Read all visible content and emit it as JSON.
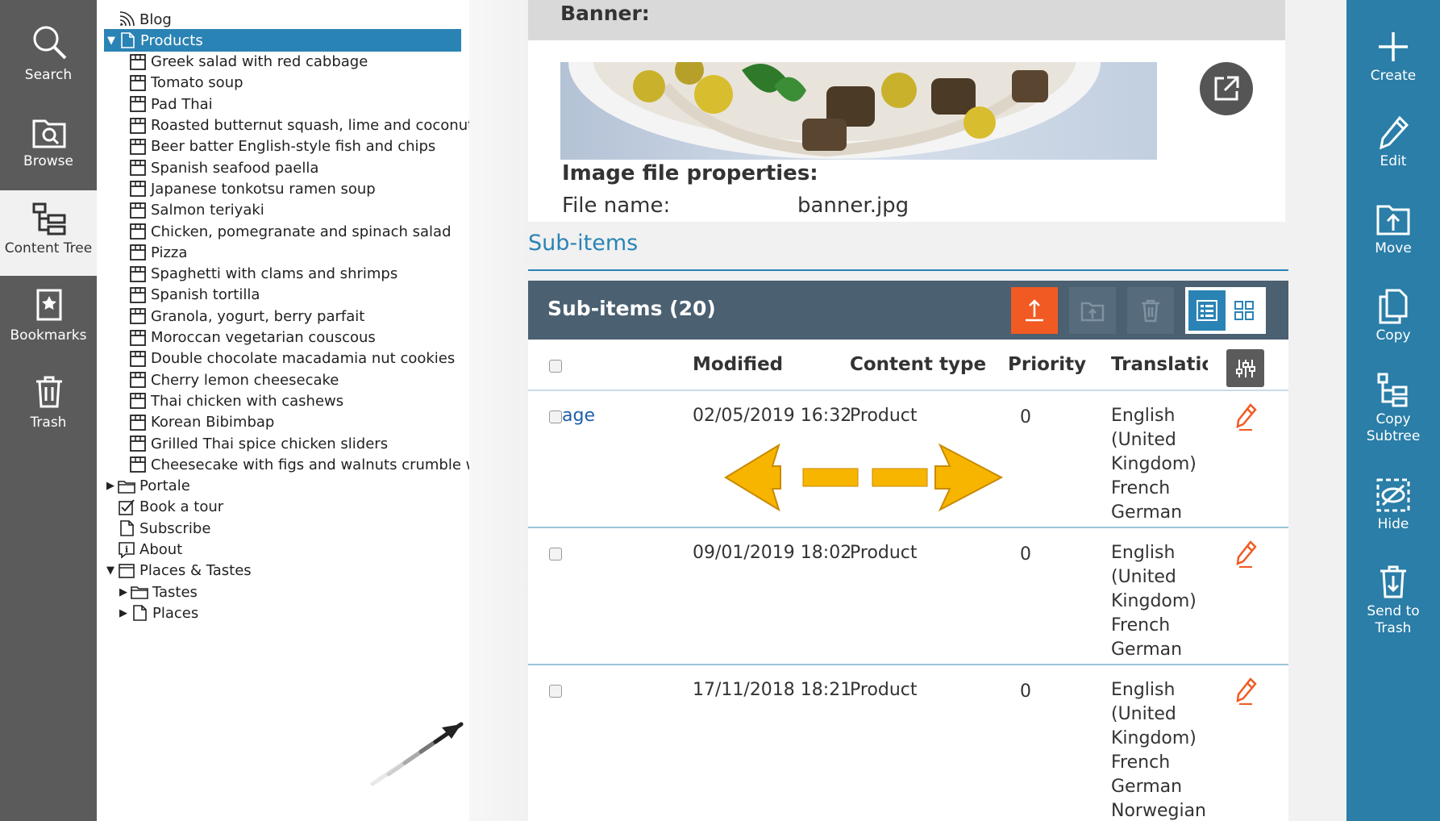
{
  "left_nav": {
    "items": [
      {
        "label": "Search",
        "icon": "search-icon"
      },
      {
        "label": "Browse",
        "icon": "browse-icon"
      },
      {
        "label": "Content Tree",
        "icon": "content-tree-icon",
        "active": true
      },
      {
        "label": "Bookmarks",
        "icon": "bookmark-icon"
      },
      {
        "label": "Trash",
        "icon": "trash-icon"
      }
    ]
  },
  "tree": {
    "items": [
      {
        "label": "Blog",
        "icon": "rss-icon",
        "toggle": ""
      },
      {
        "label": "Products",
        "icon": "page-icon",
        "toggle": "▼",
        "selected": true
      },
      {
        "label": "Greek salad with red cabbage",
        "icon": "product-icon"
      },
      {
        "label": "Tomato soup",
        "icon": "product-icon"
      },
      {
        "label": "Pad Thai",
        "icon": "product-icon"
      },
      {
        "label": "Roasted butternut squash, lime and coconut s",
        "icon": "product-icon"
      },
      {
        "label": "Beer batter English-style fish and chips",
        "icon": "product-icon"
      },
      {
        "label": "Spanish seafood paella",
        "icon": "product-icon"
      },
      {
        "label": "Japanese tonkotsu ramen soup",
        "icon": "product-icon"
      },
      {
        "label": "Salmon teriyaki",
        "icon": "product-icon"
      },
      {
        "label": "Chicken, pomegranate and spinach salad",
        "icon": "product-icon"
      },
      {
        "label": "Pizza",
        "icon": "product-icon"
      },
      {
        "label": "Spaghetti with clams and shrimps",
        "icon": "product-icon"
      },
      {
        "label": "Spanish tortilla",
        "icon": "product-icon"
      },
      {
        "label": "Granola, yogurt, berry parfait",
        "icon": "product-icon"
      },
      {
        "label": "Moroccan vegetarian couscous",
        "icon": "product-icon"
      },
      {
        "label": "Double chocolate macadamia nut cookies",
        "icon": "product-icon"
      },
      {
        "label": "Cherry lemon cheesecake",
        "icon": "product-icon"
      },
      {
        "label": "Thai chicken with cashews",
        "icon": "product-icon"
      },
      {
        "label": "Korean Bibimbap",
        "icon": "product-icon"
      },
      {
        "label": "Grilled Thai spice chicken sliders",
        "icon": "product-icon"
      },
      {
        "label": "Cheesecake with figs and walnuts crumble wit",
        "icon": "product-icon"
      },
      {
        "label": "Portale",
        "icon": "folder-icon",
        "toggle": "▶"
      },
      {
        "label": "Book a tour",
        "icon": "checkbox-icon",
        "toggle": ""
      },
      {
        "label": "Subscribe",
        "icon": "page-icon",
        "toggle": ""
      },
      {
        "label": "About",
        "icon": "info-icon",
        "toggle": ""
      },
      {
        "label": "Places & Tastes",
        "icon": "window-icon",
        "toggle": "▼"
      },
      {
        "label": "Tastes",
        "icon": "folder-icon",
        "toggle": "▶"
      },
      {
        "label": "Places",
        "icon": "page-icon",
        "toggle": "▶"
      }
    ]
  },
  "banner": {
    "heading": "Banner:",
    "image_props_title": "Image file properties:",
    "file_name_label": "File name:",
    "file_name_value": "banner.jpg"
  },
  "subitems": {
    "heading": "Sub-items",
    "bar_title": "Sub-items (20)",
    "columns": {
      "modified": "Modified",
      "content_type": "Content type",
      "priority": "Priority",
      "translations": "Translatioı"
    },
    "rows": [
      {
        "name": "age",
        "modified": "02/05/2019 16:32",
        "content_type": "Product",
        "priority": "0",
        "translations": [
          "English",
          "(United",
          "Kingdom)",
          "French",
          "German"
        ]
      },
      {
        "name": "",
        "modified": "09/01/2019 18:02",
        "content_type": "Product",
        "priority": "0",
        "translations": [
          "English",
          "(United",
          "Kingdom)",
          "French",
          "German"
        ]
      },
      {
        "name": "",
        "modified": "17/11/2018 18:21",
        "content_type": "Product",
        "priority": "0",
        "translations": [
          "English",
          "(United",
          "Kingdom)",
          "French",
          "German",
          "Norwegian"
        ]
      }
    ]
  },
  "right_bar": {
    "actions": [
      {
        "label": "Create",
        "icon": "plus-icon"
      },
      {
        "label": "Edit",
        "icon": "pencil-icon"
      },
      {
        "label": "Move",
        "icon": "move-icon"
      },
      {
        "label": "Copy",
        "icon": "copy-icon"
      },
      {
        "label": "Copy Subtree",
        "icon": "copy-subtree-icon"
      },
      {
        "label": "Hide",
        "icon": "hide-icon"
      },
      {
        "label": "Send to Trash",
        "icon": "send-to-trash-icon"
      }
    ]
  },
  "colors": {
    "accent": "#2a83b5",
    "left_nav": "#5b5b5b",
    "right_bar": "#2a7ea8",
    "bar": "#4b6071",
    "upload": "#f15a22",
    "edit_icon": "#f15a22",
    "annotation_arrow": "#f7b500"
  }
}
